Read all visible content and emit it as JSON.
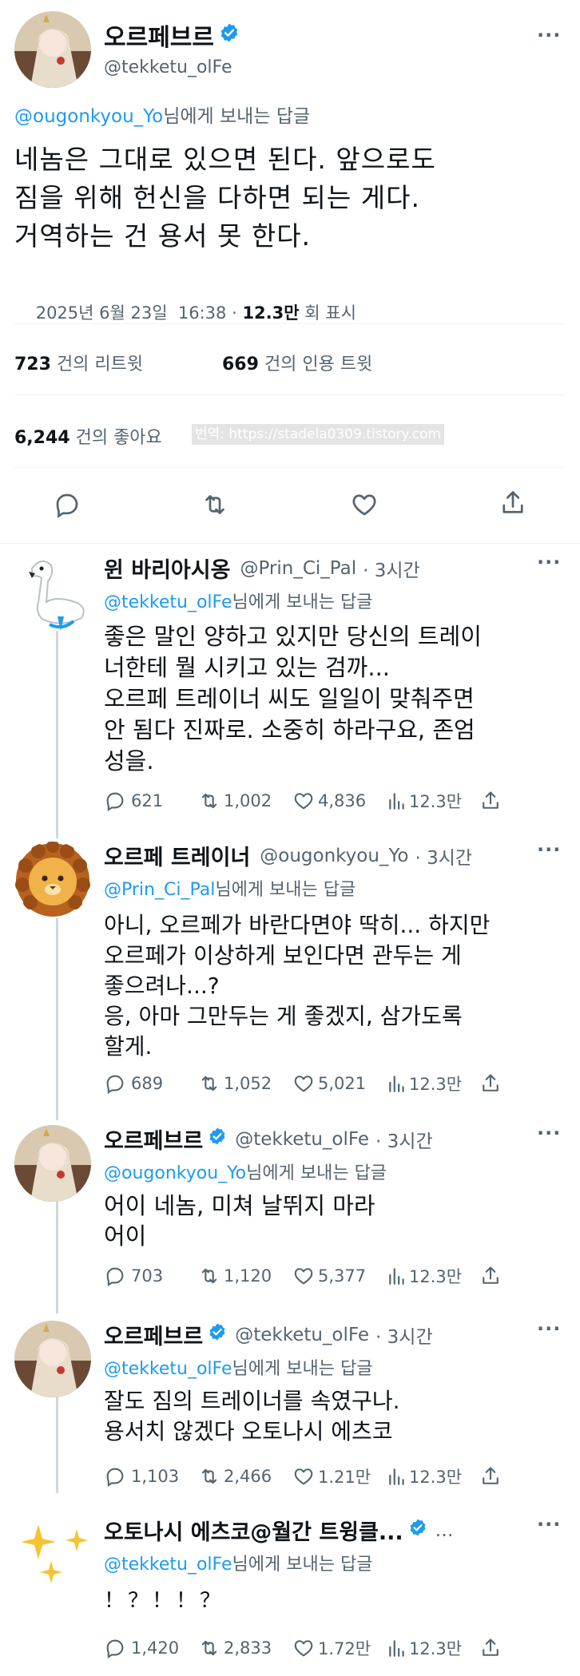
{
  "main": {
    "name": "오르페브르",
    "handle": "@tekketu_olFe",
    "reply_prefix": "@ougonkyou_Yo",
    "reply_suffix": "님에게 보내는 답글",
    "text": "네놈은 그대로 있으면 된다. 앞으로도\n짐을 위해 헌신을 다하면 되는 게다.\n거역하는 건 용서 못 한다.",
    "date": "2025년 6월 23일  16:38 · ",
    "views": "12.3만",
    "views_label": " 회 표시",
    "retweets_count": "723",
    "retweets_label": "건의 리트윗",
    "quotes_count": "669",
    "quotes_label": "건의 인용 트윗",
    "likes_count": "6,244",
    "likes_label": "건의 좋아요",
    "watermark": "번역: https://stadela0309.tistory.com"
  },
  "replies": [
    {
      "name": "윈 바리아시옹",
      "handle": "@Prin_Ci_Pal",
      "time": "· 3시간",
      "reply_prefix": "@tekketu_olFe",
      "reply_suffix": "님에게 보내는 답글",
      "text": "좋은 말인 양하고 있지만 당신의 트레이\n너한테 뭘 시키고 있는 검까...\n오르페 트레이너 씨도 일일이 맞춰주면\n안 됨다 진짜로. 소중히 하라구요, 존엄\n성을.",
      "replies": "621",
      "retweets": "1,002",
      "likes": "4,836",
      "views": "12.3만"
    },
    {
      "name": "오르페 트레이너",
      "handle": "@ougonkyou_Yo",
      "time": "· 3시간",
      "reply_prefix": "@Prin_Ci_Pal",
      "reply_suffix": "님에게 보내는 답글",
      "text": "아니, 오르페가 바란다면야 딱히... 하지만\n오르페가 이상하게 보인다면 관두는 게\n좋으려나...?\n응, 아마 그만두는 게 좋겠지, 삼가도록\n할게.",
      "replies": "689",
      "retweets": "1,052",
      "likes": "5,021",
      "views": "12.3만"
    },
    {
      "name": "오르페브르",
      "handle": "@tekketu_olFe",
      "time": "· 3시간",
      "reply_prefix": "@ougonkyou_Yo",
      "reply_suffix": "님에게 보내는 답글",
      "text": "어이 네놈, 미쳐 날뛰지 마라\n어이",
      "replies": "703",
      "retweets": "1,120",
      "likes": "5,377",
      "views": "12.3만"
    },
    {
      "name": "오르페브르",
      "handle": "@tekketu_olFe",
      "time": "· 3시간",
      "reply_prefix": "@tekketu_olFe",
      "reply_suffix": "님에게 보내는 답글",
      "text": "잘도 짐의 트레이너를 속였구나.\n용서치 않겠다 오토나시 에츠코",
      "replies": "1,103",
      "retweets": "2,466",
      "likes": "1.21만",
      "views": "12.3만"
    },
    {
      "name": "오토나시 에츠코@월간 트윙클...",
      "handle": "",
      "time": "",
      "reply_prefix": "@tekketu_olFe",
      "reply_suffix": "님에게 보내는 답글",
      "text": "！？！！？",
      "replies": "1,420",
      "retweets": "2,833",
      "likes": "1.72만",
      "views": "12.3만"
    }
  ],
  "icons": [
    "reply-icon",
    "retweet-icon",
    "like-icon",
    "share-icon",
    "views-icon",
    "verified-badge-icon",
    "more-icon"
  ],
  "colors": {
    "accent": "#1d9bf0",
    "secondary_text": "#536471",
    "divider": "#eff3f4",
    "verified": "#1d9bf0"
  }
}
